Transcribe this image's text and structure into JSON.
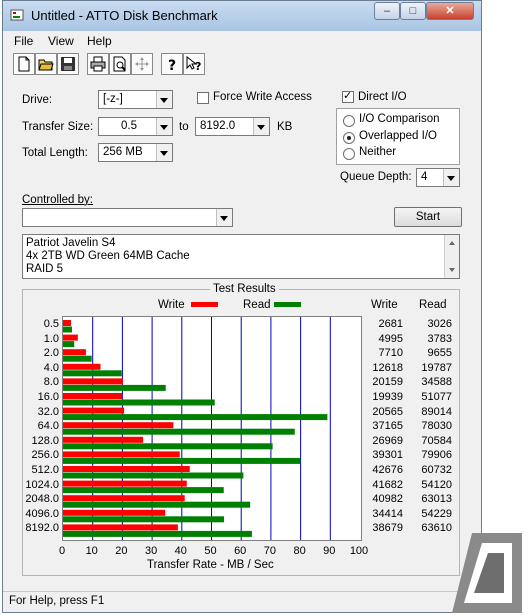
{
  "window": {
    "title": "Untitled - ATTO Disk Benchmark",
    "minimize_label": "–",
    "maximize_label": "□",
    "close_label": "✕"
  },
  "menu": {
    "file": "File",
    "view": "View",
    "help": "Help"
  },
  "toolbar": {
    "icons": [
      "new-file-icon",
      "open-folder-icon",
      "save-icon",
      "print-icon",
      "print-preview-icon",
      "move-icon",
      "help-icon",
      "context-help-icon"
    ]
  },
  "settings": {
    "drive_label": "Drive:",
    "drive_value": "[-z-]",
    "force_write_label": "Force Write Access",
    "direct_io_label": "Direct I/O",
    "direct_io_checked": "✓",
    "transfer_size_label": "Transfer Size:",
    "transfer_from": "0.5",
    "to_label": "to",
    "transfer_to": "8192.0",
    "kb_label": "KB",
    "total_length_label": "Total Length:",
    "total_length": "256 MB",
    "io_comparison": "I/O Comparison",
    "overlapped_io": "Overlapped I/O",
    "neither": "Neither",
    "queue_depth_label": "Queue Depth:",
    "queue_depth": "4",
    "controlled_by_label": "Controlled by:",
    "controlled_by_value": "",
    "start_label": "Start"
  },
  "notes": {
    "line1": "Patriot Javelin S4",
    "line2": "4x 2TB WD Green 64MB Cache",
    "line3": "RAID 5"
  },
  "results": {
    "group_title": "Test Results",
    "write_legend": "Write",
    "read_legend": "Read",
    "write_header": "Write",
    "read_header": "Read",
    "colors": {
      "write": "#ff0000",
      "read": "#008000",
      "grid": "#0000c0"
    }
  },
  "chart_data": {
    "type": "bar",
    "xlabel": "Transfer Rate - MB / Sec",
    "xlim": [
      0,
      100
    ],
    "xticks": [
      "0",
      "10",
      "20",
      "30",
      "40",
      "50",
      "60",
      "70",
      "80",
      "90",
      "100"
    ],
    "categories": [
      "0.5",
      "1.0",
      "2.0",
      "4.0",
      "8.0",
      "16.0",
      "32.0",
      "64.0",
      "128.0",
      "256.0",
      "512.0",
      "1024.0",
      "2048.0",
      "4096.0",
      "8192.0"
    ],
    "series": [
      {
        "name": "Write",
        "values": [
          2.681,
          4.995,
          7.71,
          12.618,
          20.159,
          19.939,
          20.565,
          37.165,
          26.969,
          39.301,
          42.676,
          41.682,
          40.982,
          34.414,
          38.679
        ],
        "labels": [
          "2681",
          "4995",
          "7710",
          "12618",
          "20159",
          "19939",
          "20565",
          "37165",
          "26969",
          "39301",
          "42676",
          "41682",
          "40982",
          "34414",
          "38679"
        ]
      },
      {
        "name": "Read",
        "values": [
          3.026,
          3.783,
          9.655,
          19.787,
          34.588,
          51.077,
          89.014,
          78.03,
          70.584,
          79.906,
          60.732,
          54.12,
          63.013,
          54.229,
          63.61
        ],
        "labels": [
          "3026",
          "3783",
          "9655",
          "19787",
          "34588",
          "51077",
          "89014",
          "78030",
          "70584",
          "79906",
          "60732",
          "54120",
          "63013",
          "54229",
          "63610"
        ]
      }
    ]
  },
  "status": {
    "text": "For Help, press F1"
  }
}
